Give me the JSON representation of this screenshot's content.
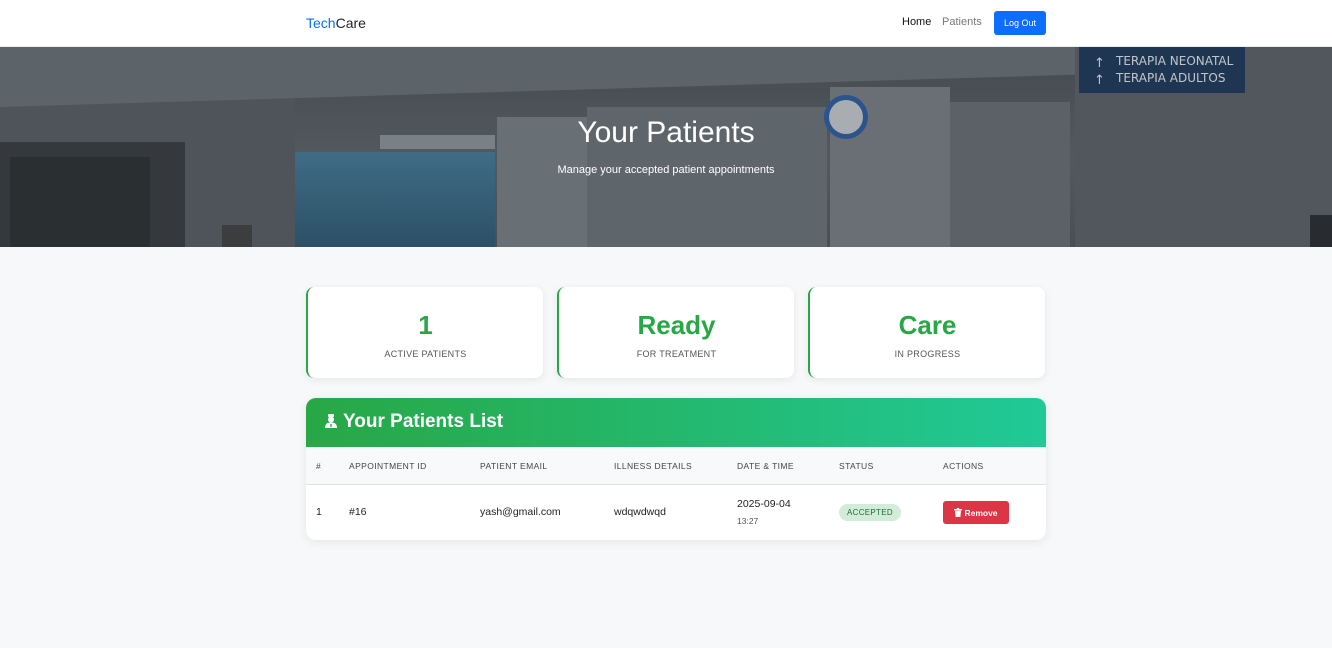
{
  "nav": {
    "brand_part1": "Tech",
    "brand_part2": "Care",
    "links": [
      "Home",
      "Patients"
    ],
    "logout_label": "Log Out"
  },
  "hero": {
    "title": "Your Patients",
    "subtitle": "Manage your accepted patient appointments"
  },
  "stats": [
    {
      "value": "1",
      "label": "ACTIVE PATIENTS"
    },
    {
      "value": "Ready",
      "label": "FOR TREATMENT"
    },
    {
      "value": "Care",
      "label": "IN PROGRESS"
    }
  ],
  "patients_panel": {
    "title": "Your Patients List",
    "icon": "user-nurse-icon",
    "columns": [
      "#",
      "APPOINTMENT ID",
      "PATIENT EMAIL",
      "ILLNESS DETAILS",
      "DATE & TIME",
      "STATUS",
      "ACTIONS"
    ],
    "rows": [
      {
        "index": "1",
        "appointment_id": "#16",
        "email": "yash@gmail.com",
        "illness": "wdqwdwqd",
        "date": "2025-09-04",
        "time": "13:27",
        "status": "ACCEPTED",
        "action_label": "Remove",
        "action_icon": "trash-icon"
      }
    ]
  },
  "colors": {
    "accent": "#0d6efd",
    "success": "#28a745",
    "teal": "#20c997",
    "danger": "#dc3545"
  }
}
